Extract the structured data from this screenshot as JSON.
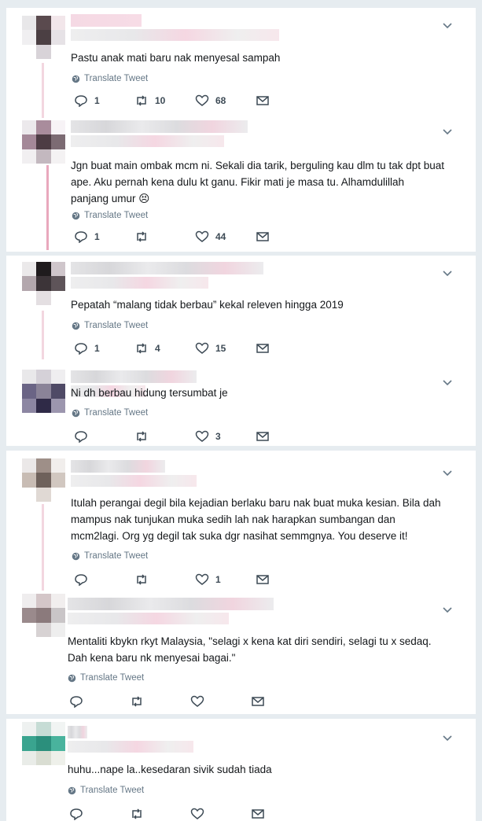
{
  "tweets": [
    {
      "text": "Pastu anak mati baru nak menyesal sampah",
      "translate_label": "Translate Tweet",
      "replies": "1",
      "retweets": "10",
      "likes": "68"
    },
    {
      "text": "Jgn buat main ombak mcm ni. Sekali dia tarik, berguling kau dlm tu tak dpt buat ape. Aku pernah kena dulu kt ganu. Fikir mati je masa tu. Alhamdulillah panjang umur 😣",
      "translate_label": "Translate Tweet",
      "replies": "1",
      "retweets": "",
      "likes": "44"
    },
    {
      "text": "Pepatah “malang tidak berbau” kekal releven hingga 2019",
      "translate_label": "Translate Tweet",
      "replies": "1",
      "retweets": "4",
      "likes": "15"
    },
    {
      "text": "Ni dh berbau hidung tersumbat je",
      "translate_label": "Translate Tweet",
      "replies": "",
      "retweets": "",
      "likes": "3"
    },
    {
      "text": "Itulah perangai degil bila kejadian berlaku baru nak buat muka kesian. Bila dah mampus nak tunjukan muka sedih lah nak harapkan sumbangan dan mcm2lagi. Org yg degil tak suka dgr nasihat semmgnya. You deserve it!",
      "translate_label": "Translate Tweet",
      "replies": "",
      "retweets": "",
      "likes": "1"
    },
    {
      "text": "Mentaliti kbykn rkyt Malaysia, \"selagi x kena kat diri sendiri, selagi tu x sedaq. Dah kena baru nk menyesai bagai.\"",
      "translate_label": "Translate Tweet",
      "replies": "",
      "retweets": "",
      "likes": ""
    },
    {
      "text": "huhu...nape la..kesedaran sivik sudah tiada",
      "translate_label": "Translate Tweet",
      "replies": "",
      "retweets": "",
      "likes": ""
    }
  ],
  "colors": {
    "background": "#e6ecf0",
    "card": "#ffffff",
    "thread_line": "#e9a8bd",
    "icon": "#3d4a55",
    "secondary_text": "#657786"
  },
  "icons": {
    "reply": "reply-icon",
    "retweet": "retweet-icon",
    "like": "heart-icon",
    "dm": "mail-icon",
    "translate": "globe-icon",
    "menu": "chevron-down-icon"
  }
}
